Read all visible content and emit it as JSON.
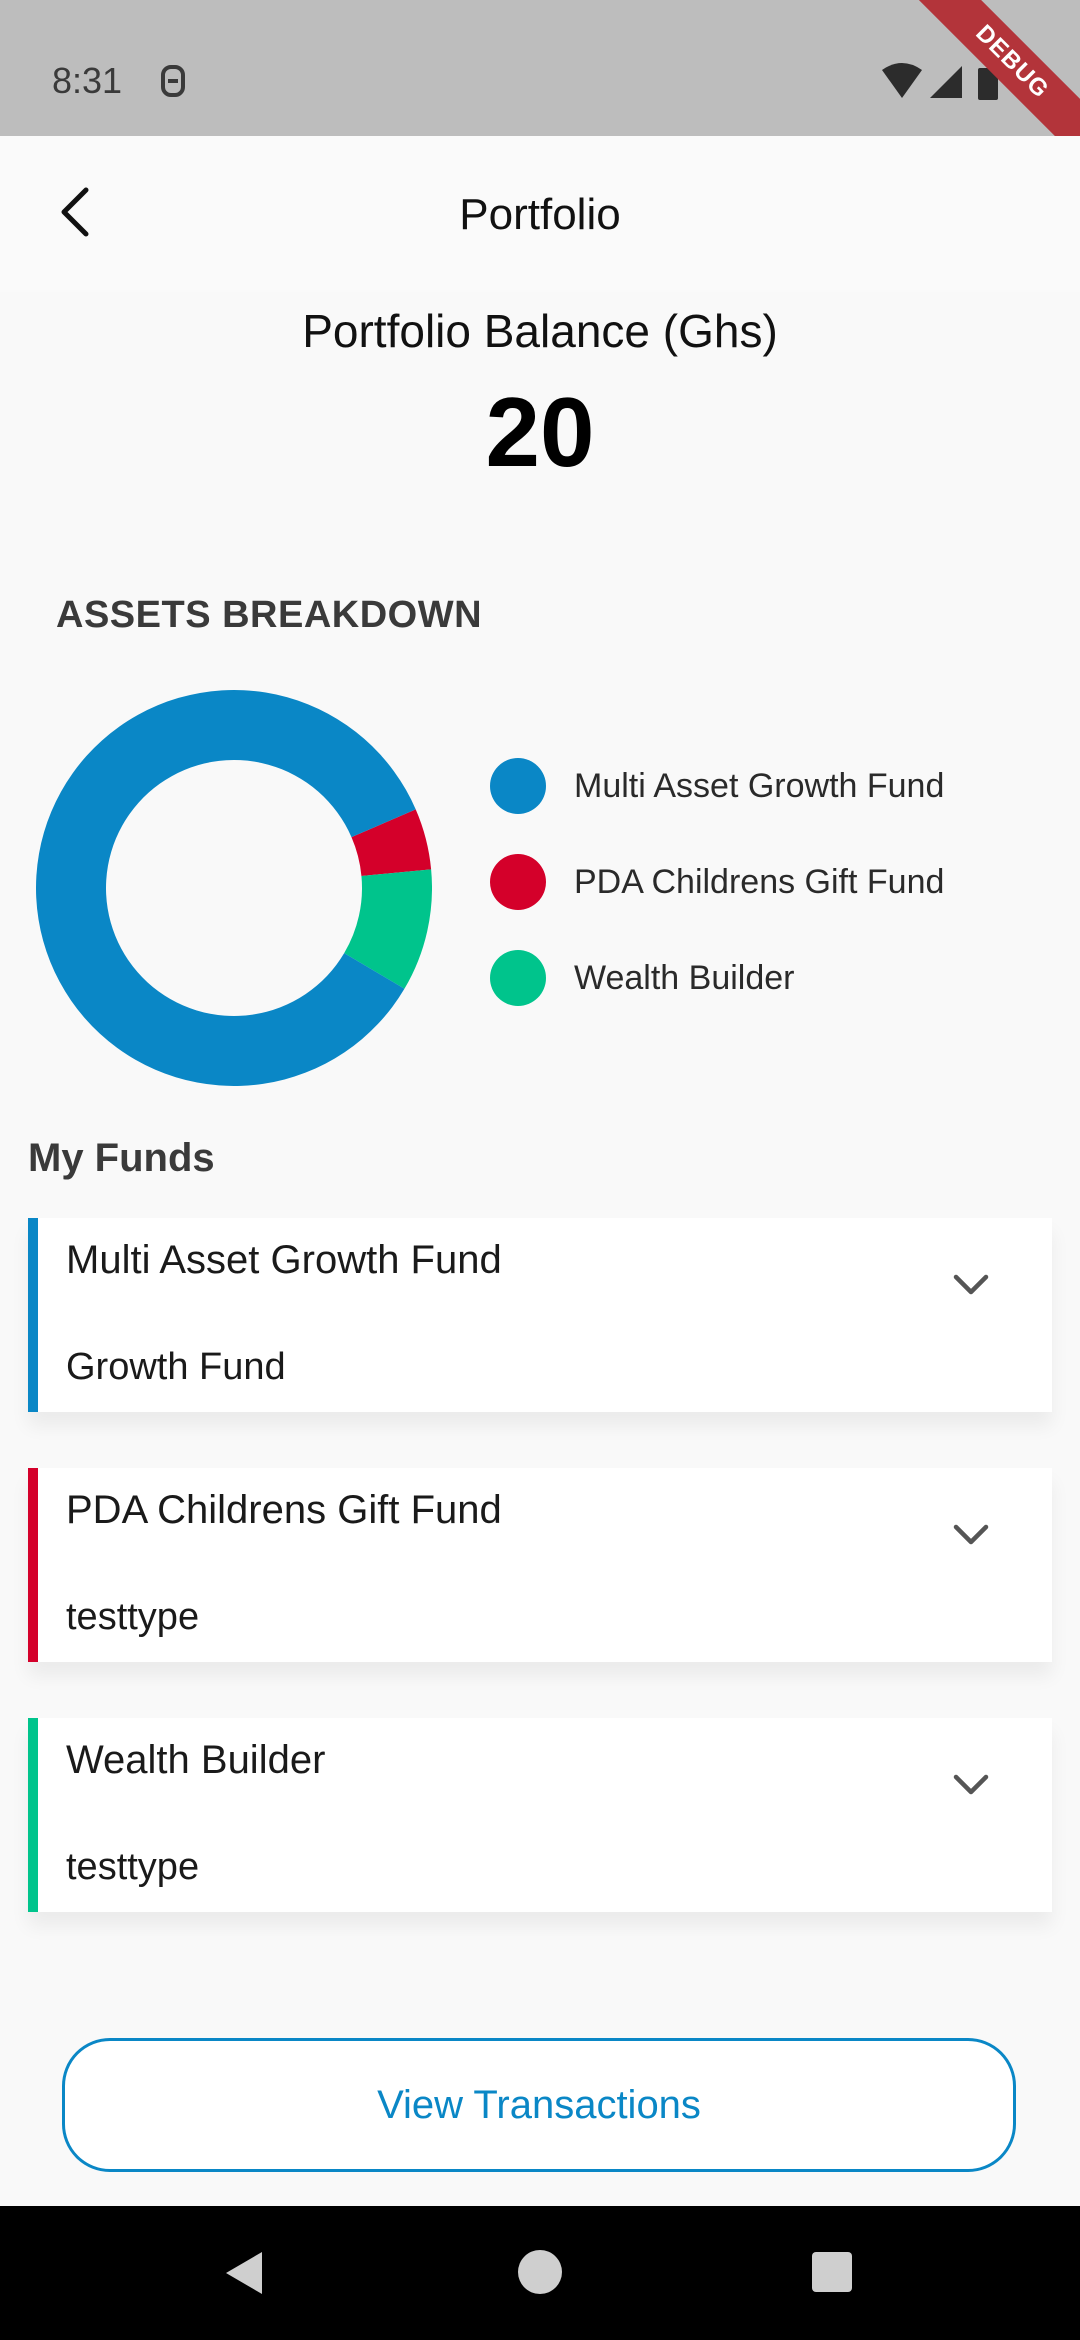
{
  "status_bar": {
    "time": "8:31",
    "debug_label": "DEBUG"
  },
  "app_bar": {
    "title": "Portfolio",
    "back_icon": "back-arrow-icon"
  },
  "balance": {
    "label": "Portfolio Balance (Ghs)",
    "value": "20"
  },
  "assets_breakdown": {
    "heading": "ASSETS BREAKDOWN"
  },
  "chart_data": {
    "type": "pie",
    "donut": true,
    "categories": [
      "Multi Asset Growth Fund",
      "PDA Childrens Gift Fund",
      "Wealth Builder"
    ],
    "values": [
      85,
      5,
      10
    ],
    "colors": [
      "#0a87c6",
      "#d4002a",
      "#00c48c"
    ],
    "legend_position": "right"
  },
  "funds": {
    "heading": "My Funds",
    "items": [
      {
        "name": "Multi Asset Growth Fund",
        "type": "Growth Fund",
        "color": "#0a87c6"
      },
      {
        "name": "PDA Childrens Gift Fund",
        "type": "testtype",
        "color": "#d4002a"
      },
      {
        "name": "Wealth Builder",
        "type": "testtype",
        "color": "#00c48c"
      }
    ]
  },
  "actions": {
    "view_transactions": "View Transactions"
  }
}
